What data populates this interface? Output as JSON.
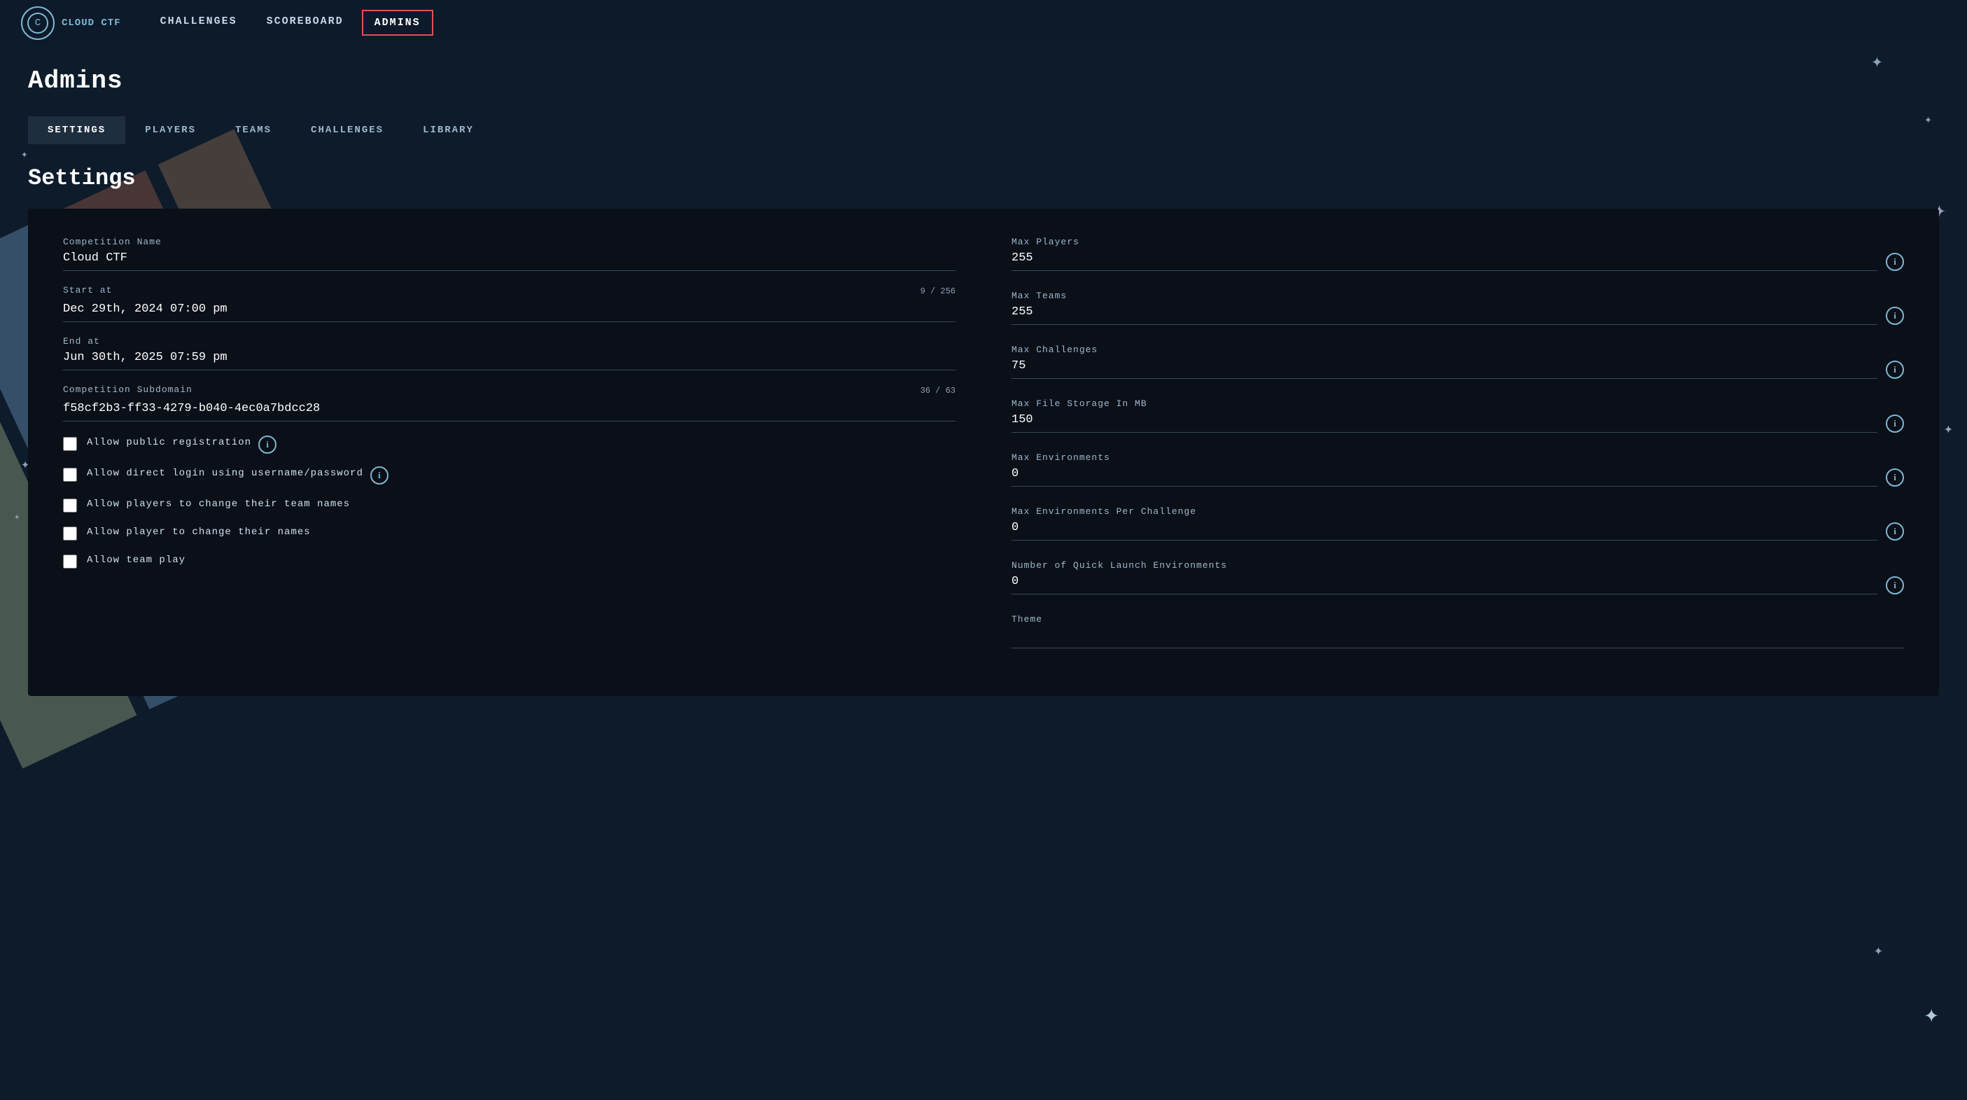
{
  "navbar": {
    "logo_text": "CLOUD CTF",
    "links": [
      {
        "label": "CHALLENGES",
        "active": false,
        "id": "challenges"
      },
      {
        "label": "SCOREBOARD",
        "active": false,
        "id": "scoreboard"
      },
      {
        "label": "ADMINS",
        "active": true,
        "id": "admins"
      }
    ]
  },
  "page": {
    "title": "Admins",
    "settings_title": "Settings"
  },
  "sub_tabs": [
    {
      "label": "SETTINGS",
      "active": true
    },
    {
      "label": "PLAYERS",
      "active": false
    },
    {
      "label": "TEAMS",
      "active": false
    },
    {
      "label": "CHALLENGES",
      "active": false
    },
    {
      "label": "LIBRARY",
      "active": false
    }
  ],
  "settings": {
    "left": {
      "competition_name_label": "Competition Name",
      "competition_name_value": "Cloud CTF",
      "start_at_label": "Start at",
      "start_at_value": "Dec 29th, 2024 07:00 pm",
      "start_char_count": "9 / 256",
      "end_at_label": "End at",
      "end_at_value": "Jun 30th, 2025 07:59 pm",
      "subdomain_label": "Competition Subdomain",
      "subdomain_value": "f58cf2b3-ff33-4279-b040-4ec0a7bdcc28",
      "subdomain_char_count": "36 / 63",
      "checkboxes": [
        {
          "label": "Allow public registration",
          "checked": false,
          "has_info": true
        },
        {
          "label": "Allow direct login using username/password",
          "checked": false,
          "has_info": true
        },
        {
          "label": "Allow players to change their team names",
          "checked": false,
          "has_info": false
        },
        {
          "label": "Allow player to change their names",
          "checked": false,
          "has_info": false
        },
        {
          "label": "Allow team play",
          "checked": false,
          "has_info": false
        }
      ]
    },
    "right": {
      "fields": [
        {
          "label": "Max Players",
          "value": "255",
          "has_info": true
        },
        {
          "label": "Max Teams",
          "value": "255",
          "has_info": true
        },
        {
          "label": "Max Challenges",
          "value": "75",
          "has_info": true
        },
        {
          "label": "Max File Storage In MB",
          "value": "150",
          "has_info": true
        },
        {
          "label": "Max Environments",
          "value": "0",
          "has_info": true
        },
        {
          "label": "Max Environments Per Challenge",
          "value": "0",
          "has_info": true
        },
        {
          "label": "Number of Quick Launch Environments",
          "value": "0",
          "has_info": true
        },
        {
          "label": "Theme",
          "value": "",
          "has_info": false
        }
      ]
    }
  }
}
